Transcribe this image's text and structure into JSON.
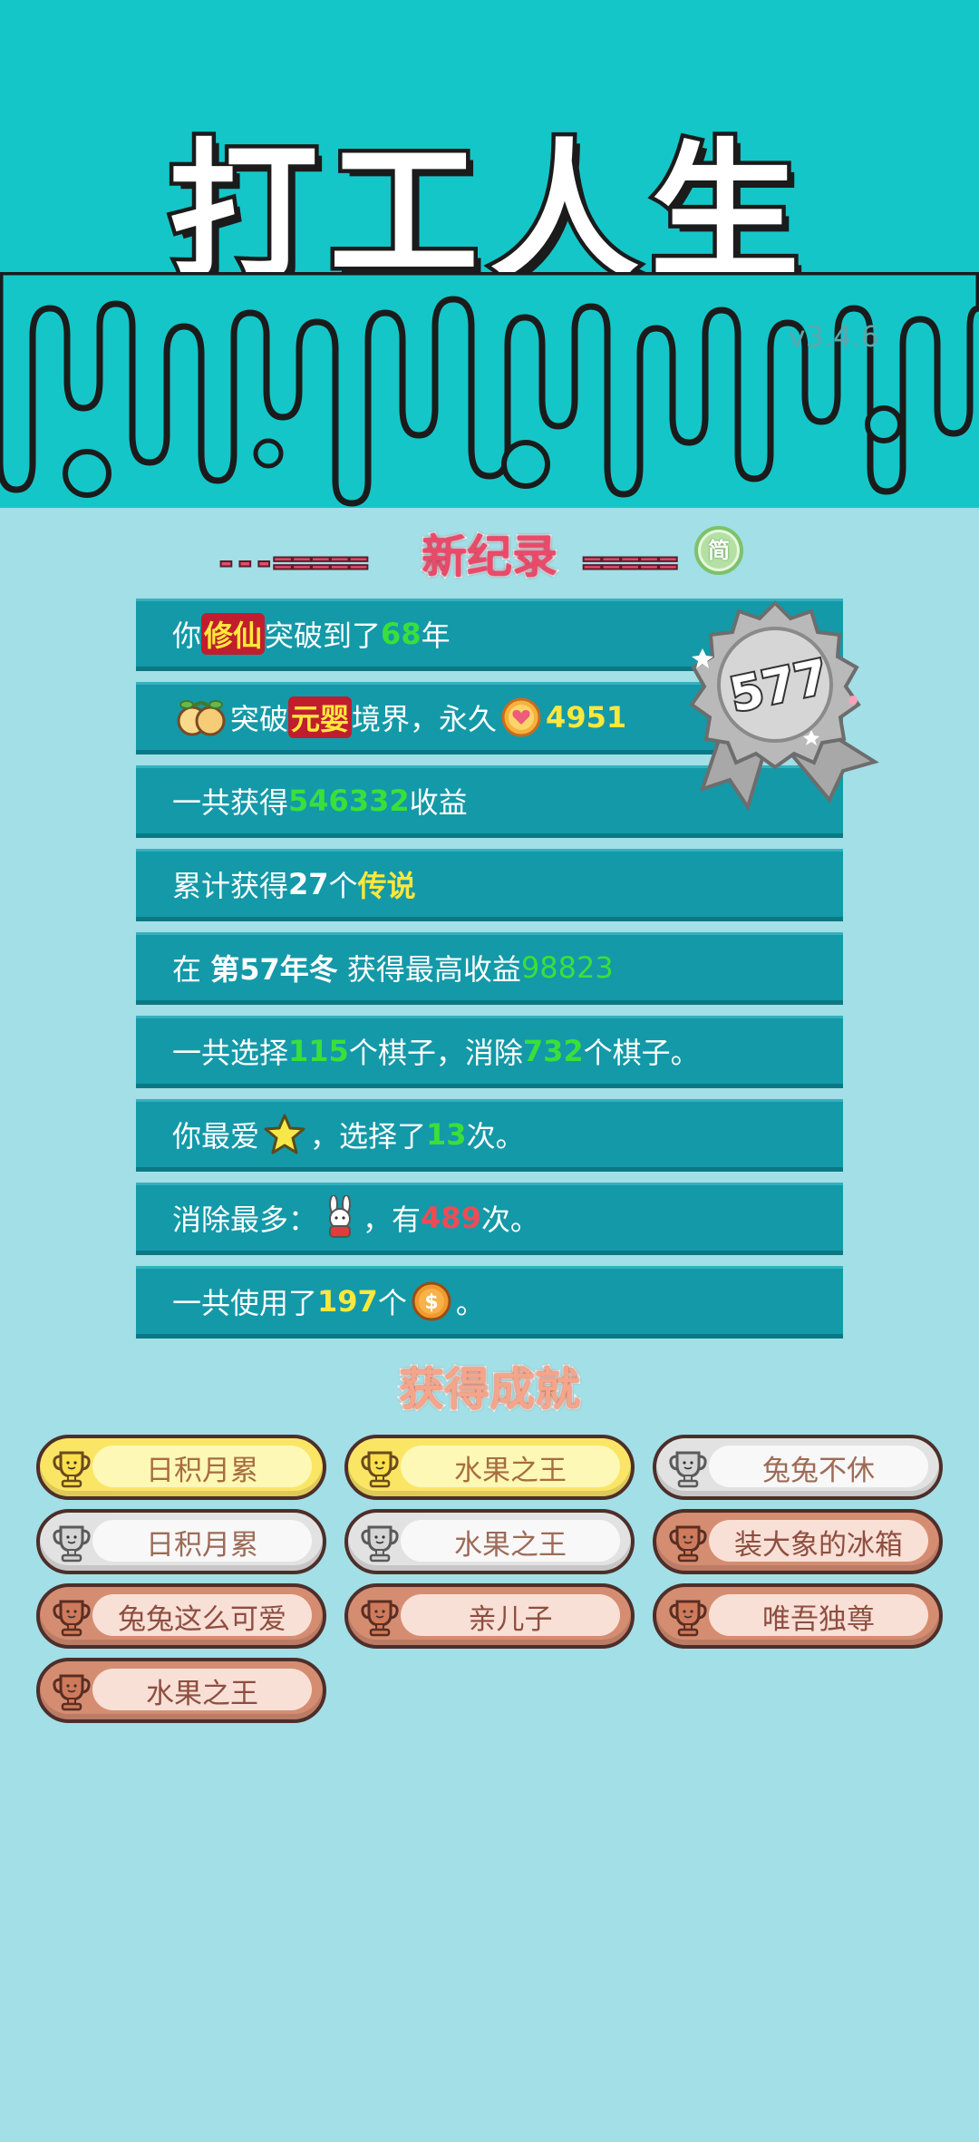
{
  "header": {
    "title": "打工人生",
    "version": "v3.4.6"
  },
  "record": {
    "title": "新纪录",
    "jian_label": "简",
    "badge_number": "577"
  },
  "stats": {
    "row1": {
      "a": "你",
      "b": "修仙",
      "c": "突破到了",
      "d": "68",
      "e": "年"
    },
    "row2": {
      "a": "突破",
      "b": "元婴",
      "c": "境界，永久",
      "d": "4951"
    },
    "row3": {
      "a": "一共获得",
      "b": "546332",
      "c": "收益"
    },
    "row4": {
      "a": "累计获得",
      "b": "27",
      "c": "个",
      "d": "传说"
    },
    "row5": {
      "a": "在 ",
      "b": "第57年冬",
      "c": " 获得最高收益",
      "d": "98823"
    },
    "row6": {
      "a": "一共选择",
      "b": "115",
      "c": "个棋子，消除",
      "d": "732",
      "e": "个棋子。"
    },
    "row7": {
      "a": "你最爱",
      "b": "，选择了",
      "c": "13",
      "d": "次。"
    },
    "row8": {
      "a": "消除最多：",
      "b": "，有",
      "c": "489",
      "d": "次。"
    },
    "row9": {
      "a": "一共使用了",
      "b": "197",
      "c": "个",
      "d": "。"
    }
  },
  "achievements": {
    "title": "获得成就",
    "items": [
      {
        "label": "日积月累",
        "tier": "gold"
      },
      {
        "label": "水果之王",
        "tier": "gold"
      },
      {
        "label": "兔兔不休",
        "tier": "silver"
      },
      {
        "label": "日积月累",
        "tier": "silver"
      },
      {
        "label": "水果之王",
        "tier": "silver"
      },
      {
        "label": "装大象的冰箱",
        "tier": "bronze"
      },
      {
        "label": "兔兔这么可爱",
        "tier": "bronze"
      },
      {
        "label": "亲儿子",
        "tier": "bronze"
      },
      {
        "label": "唯吾独尊",
        "tier": "bronze"
      },
      {
        "label": "水果之王",
        "tier": "bronze"
      }
    ]
  },
  "colors": {
    "header_bg": "#15c6c8",
    "page_bg": "#a2dfe6",
    "row_bg": "#1499a8",
    "highlight_green": "#39e03a",
    "highlight_yellow": "#ffe83b",
    "highlight_red": "#f04a56",
    "record_red": "#e94a6a"
  },
  "icons": [
    "peach-icon",
    "heart-coin-icon",
    "star-icon",
    "rabbit-icon",
    "dollar-coin-icon",
    "trophy-icon",
    "medal-badge-icon"
  ]
}
